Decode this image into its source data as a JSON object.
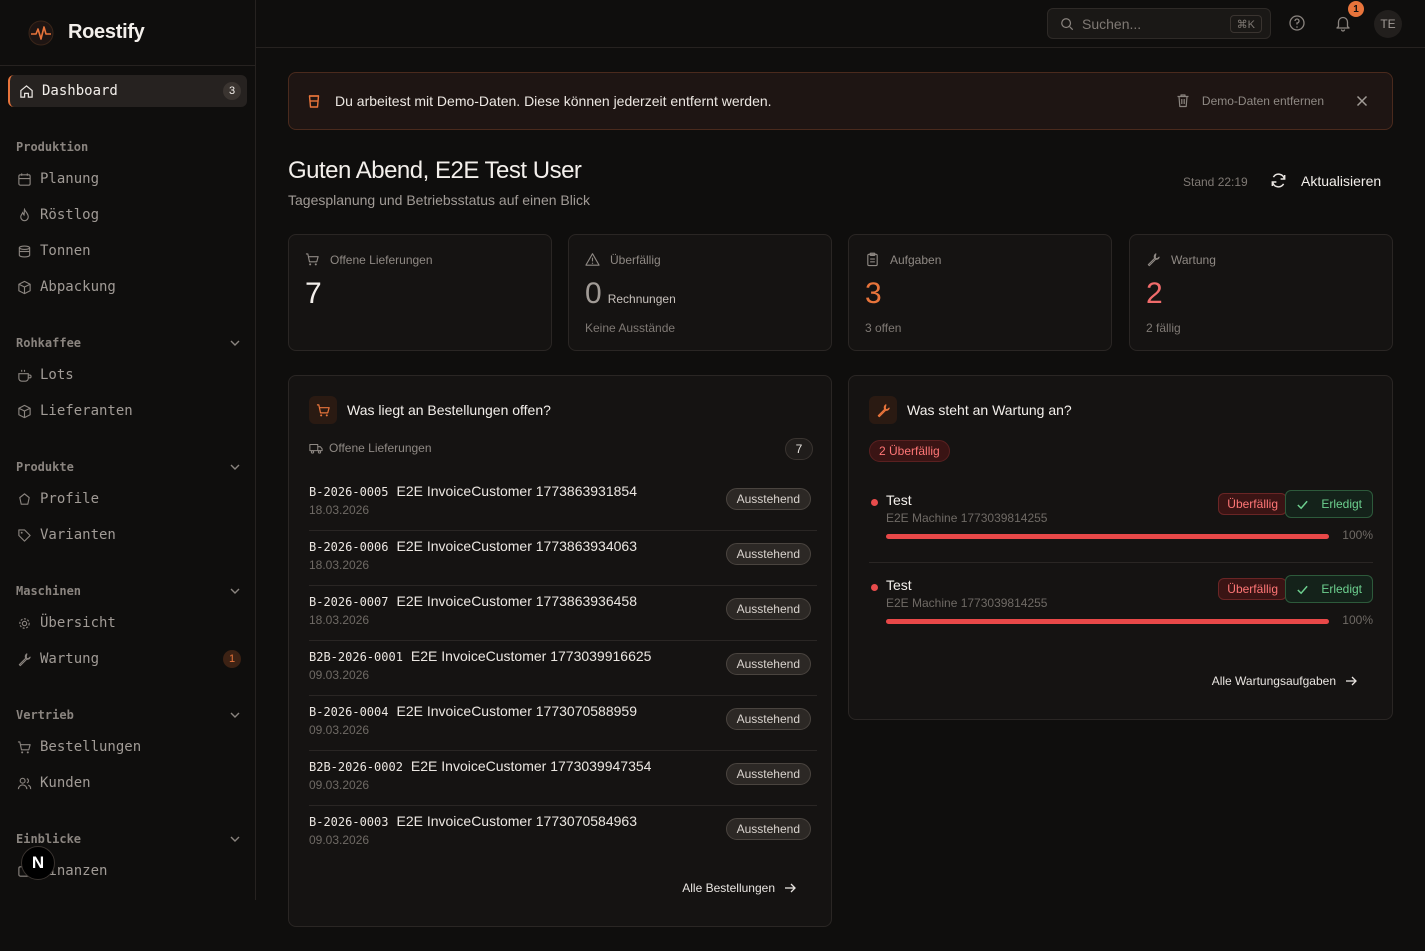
{
  "brand": {
    "name": "Roestify"
  },
  "sidebar": {
    "dashboard": {
      "label": "Dashboard",
      "badge": "3"
    },
    "sections": [
      {
        "label": "Produktion",
        "items": [
          "Planung",
          "Röstlog",
          "Tonnen",
          "Abpackung"
        ]
      },
      {
        "label": "Rohkaffee",
        "items": [
          "Lots",
          "Lieferanten"
        ]
      },
      {
        "label": "Produkte",
        "items": [
          "Profile",
          "Varianten"
        ]
      },
      {
        "label": "Maschinen",
        "items": [
          "Übersicht",
          "Wartung"
        ],
        "wartung_badge": "1"
      },
      {
        "label": "Vertrieb",
        "items": [
          "Bestellungen",
          "Kunden"
        ]
      },
      {
        "label": "Einblicke",
        "items": [
          "Finanzen"
        ]
      }
    ],
    "next_badge": "N"
  },
  "topbar": {
    "search_placeholder": "Suchen...",
    "search_shortcut": "⌘K",
    "notification_count": "1",
    "avatar_initials": "TE"
  },
  "banner": {
    "message": "Du arbeitest mit Demo-Daten. Diese können jederzeit entfernt werden.",
    "remove_label": "Demo-Daten entfernen"
  },
  "greeting": {
    "title": "Guten Abend, E2E Test User",
    "subtitle": "Tagesplanung und Betriebsstatus auf einen Blick",
    "stand": "Stand 22:19",
    "refresh_label": "Aktualisieren"
  },
  "stats": [
    {
      "label": "Offene Lieferungen",
      "value": "7",
      "unit": "",
      "sub": "",
      "color": "#f3efeb"
    },
    {
      "label": "Überfällig",
      "value": "0",
      "unit": "Rechnungen",
      "sub": "Keine Ausstände",
      "color": "#a19b96"
    },
    {
      "label": "Aufgaben",
      "value": "3",
      "unit": "",
      "sub": "3 offen",
      "color": "#e8743b"
    },
    {
      "label": "Wartung",
      "value": "2",
      "unit": "",
      "sub": "2 fällig",
      "color": "#f06b6b"
    }
  ],
  "orders_panel": {
    "title": "Was liegt an Bestellungen offen?",
    "subheader": "Offene Lieferungen",
    "count": "7",
    "rows": [
      {
        "code": "B-2026-0005",
        "customer": "E2E InvoiceCustomer 1773863931854",
        "date": "18.03.2026",
        "status": "Ausstehend"
      },
      {
        "code": "B-2026-0006",
        "customer": "E2E InvoiceCustomer 1773863934063",
        "date": "18.03.2026",
        "status": "Ausstehend"
      },
      {
        "code": "B-2026-0007",
        "customer": "E2E InvoiceCustomer 1773863936458",
        "date": "18.03.2026",
        "status": "Ausstehend"
      },
      {
        "code": "B2B-2026-0001",
        "customer": "E2E InvoiceCustomer 1773039916625",
        "date": "09.03.2026",
        "status": "Ausstehend"
      },
      {
        "code": "B-2026-0004",
        "customer": "E2E InvoiceCustomer 1773070588959",
        "date": "09.03.2026",
        "status": "Ausstehend"
      },
      {
        "code": "B2B-2026-0002",
        "customer": "E2E InvoiceCustomer 1773039947354",
        "date": "09.03.2026",
        "status": "Ausstehend"
      },
      {
        "code": "B-2026-0003",
        "customer": "E2E InvoiceCustomer 1773070584963",
        "date": "09.03.2026",
        "status": "Ausstehend"
      }
    ],
    "link_label": "Alle Bestellungen"
  },
  "maintenance_panel": {
    "title": "Was steht an Wartung an?",
    "overdue_pill": "2 Überfällig",
    "items": [
      {
        "title": "Test",
        "machine": "E2E Machine 1773039814255",
        "status": "Überfällig",
        "action": "Erledigt",
        "progress": 1.0,
        "progress_label": "100%"
      },
      {
        "title": "Test",
        "machine": "E2E Machine 1773039814255",
        "status": "Überfällig",
        "action": "Erledigt",
        "progress": 1.0,
        "progress_label": "100%"
      }
    ],
    "link_label": "Alle Wartungsaufgaben"
  }
}
